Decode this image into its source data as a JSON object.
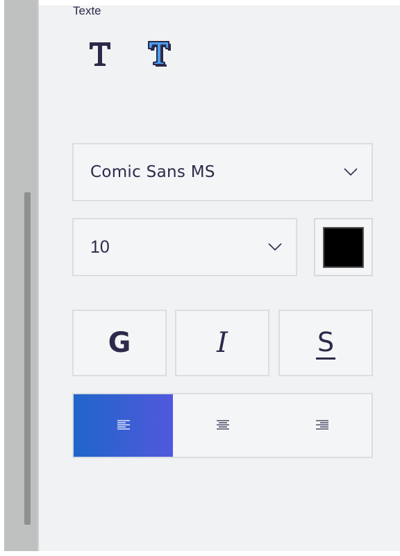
{
  "panel": {
    "section_label": "Texte",
    "text_icons": [
      {
        "icon": "text-plain-icon"
      },
      {
        "icon": "text-3d-icon"
      }
    ]
  },
  "font": {
    "family_value": "Comic Sans MS",
    "size_value": "10",
    "color": "#000000"
  },
  "style_buttons": {
    "bold_label": "G",
    "italic_label": "I",
    "underline_label": "S"
  },
  "alignment": {
    "options": [
      "align-left-icon",
      "align-center-icon",
      "align-right-icon"
    ],
    "active": "left",
    "active_gradient": [
      "#1f66c9",
      "#5158dc"
    ]
  }
}
